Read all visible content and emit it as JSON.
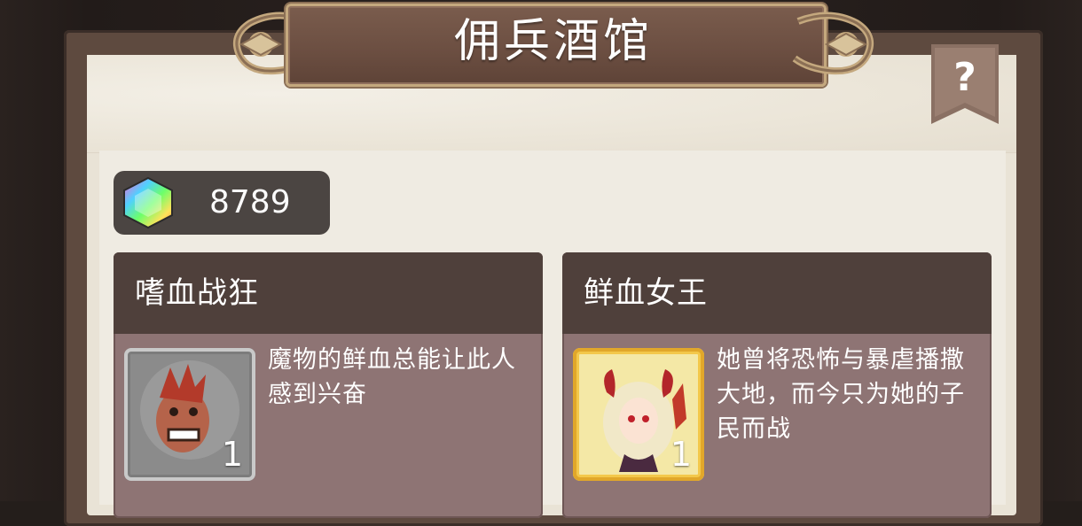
{
  "title": "佣兵酒馆",
  "help": {
    "label": "?"
  },
  "currency": {
    "icon": "rainbow-gem-icon",
    "amount": "8789"
  },
  "cards": [
    {
      "name": "嗜血战狂",
      "description": "魔物的鲜血总能让此人感到兴奋",
      "count": "1",
      "frame": "silver",
      "portrait_icon": "berserker-portrait-icon"
    },
    {
      "name": "鲜血女王",
      "description": "她曾将恐怖与暴虐播撒大地，而今只为她的子民而战",
      "count": "1",
      "frame": "gold",
      "portrait_icon": "blood-queen-portrait-icon"
    }
  ],
  "colors": {
    "banner": "#6b4e41",
    "card_body": "#8e7474",
    "card_header": "#4f403b",
    "counter_bg": "#4b4542"
  }
}
